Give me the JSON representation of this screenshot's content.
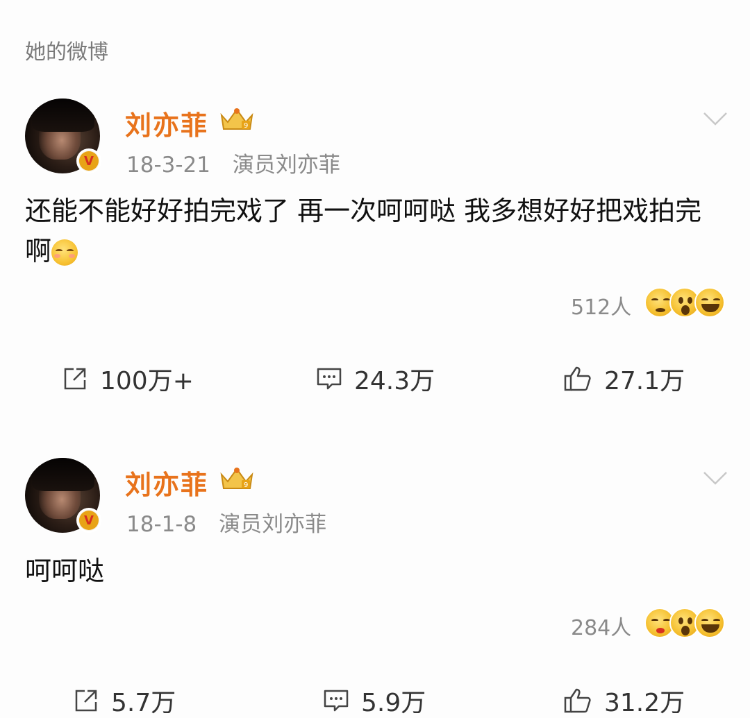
{
  "section_label": "她的微博",
  "posts": [
    {
      "author": "刘亦菲",
      "date": "18-3-21",
      "source": "演员刘亦菲",
      "text": "还能不能好好拍完戏了 再一次呵呵哒 我多想好好把戏拍完啊",
      "reactions_count": "512人",
      "repost_count": "100万+",
      "comment_count": "24.3万",
      "like_count": "27.1万"
    },
    {
      "author": "刘亦菲",
      "date": "18-1-8",
      "source": "演员刘亦菲",
      "text": "呵呵哒",
      "reactions_count": "284人",
      "repost_count": "5.7万",
      "comment_count": "5.9万",
      "like_count": "31.2万"
    }
  ],
  "icons": {
    "verified": "verified-v-badge",
    "crown": "crown-badge",
    "expand": "chevron-down-icon",
    "repost": "share-icon",
    "comment": "comment-icon",
    "like": "thumbs-up-icon"
  },
  "colors": {
    "author": "#e8731c",
    "meta": "#8a8a8a",
    "text": "#111111"
  }
}
